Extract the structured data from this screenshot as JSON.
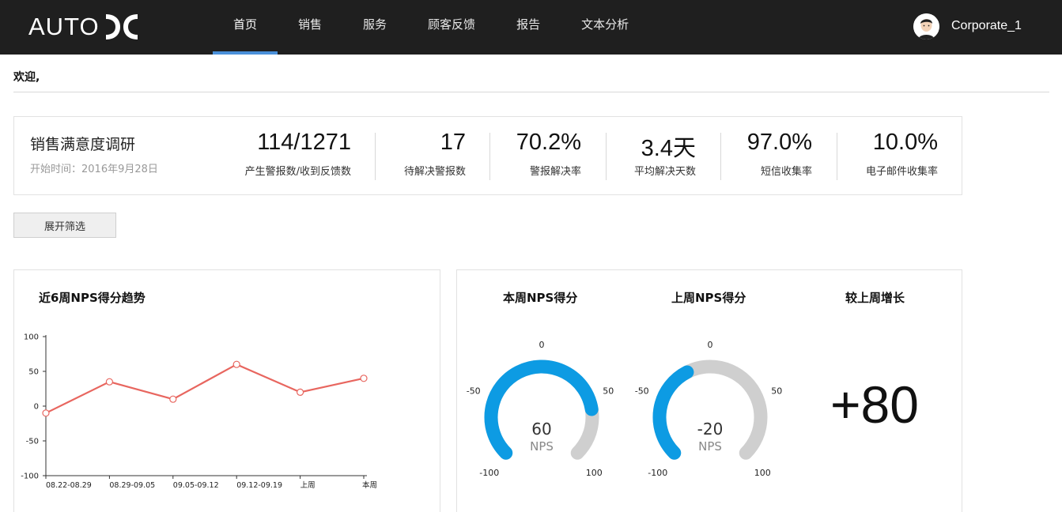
{
  "header": {
    "logo_text": "AUTO",
    "nav": [
      {
        "label": "首页",
        "active": true
      },
      {
        "label": "销售",
        "active": false
      },
      {
        "label": "服务",
        "active": false
      },
      {
        "label": "顾客反馈",
        "active": false
      },
      {
        "label": "报告",
        "active": false
      },
      {
        "label": "文本分析",
        "active": false
      }
    ],
    "user_name": "Corporate_1"
  },
  "welcome": "欢迎,",
  "survey": {
    "title": "销售满意度调研",
    "start_date": "开始时间：2016年9月28日",
    "metrics": [
      {
        "value": "114/1271",
        "label": "产生警报数/收到反馈数"
      },
      {
        "value": "17",
        "label": "待解决警报数"
      },
      {
        "value": "70.2%",
        "label": "警报解决率"
      },
      {
        "value": "3.4天",
        "label": "平均解决天数"
      },
      {
        "value": "97.0%",
        "label": "短信收集率"
      },
      {
        "value": "10.0%",
        "label": "电子邮件收集率"
      }
    ]
  },
  "filter_button": "展开筛选",
  "trend_panel": {
    "title": "近6周NPS得分趋势"
  },
  "nps_panel": {
    "this_week_title": "本周NPS得分",
    "last_week_title": "上周NPS得分",
    "growth_title": "较上周增长",
    "growth_value": "+80",
    "unit": "NPS"
  },
  "colors": {
    "accent": "#4a90d9",
    "line": "#e8665f",
    "gauge_fill": "#0d9be3",
    "gauge_track": "#cfcfcf",
    "topbar": "#1f1f1f"
  },
  "chart_data": [
    {
      "type": "line",
      "title": "近6周NPS得分趋势",
      "categories": [
        "08.22-08.29",
        "08.29-09.05",
        "09.05-09.12",
        "09.12-09.19",
        "上周",
        "本周"
      ],
      "values": [
        -10,
        35,
        10,
        60,
        20,
        40
      ],
      "ylim": [
        -100,
        100
      ],
      "yticks": [
        100,
        50,
        0,
        -50,
        -100
      ],
      "grid": false,
      "legend": "none"
    },
    {
      "type": "gauge",
      "title": "本周NPS得分",
      "value": 60,
      "unit": "NPS",
      "range": [
        -100,
        100
      ],
      "tick_labels": [
        "-100",
        "-50",
        "0",
        "50",
        "100"
      ]
    },
    {
      "type": "gauge",
      "title": "上周NPS得分",
      "value": -20,
      "unit": "NPS",
      "range": [
        -100,
        100
      ],
      "tick_labels": [
        "-100",
        "-50",
        "0",
        "50",
        "100"
      ]
    }
  ]
}
